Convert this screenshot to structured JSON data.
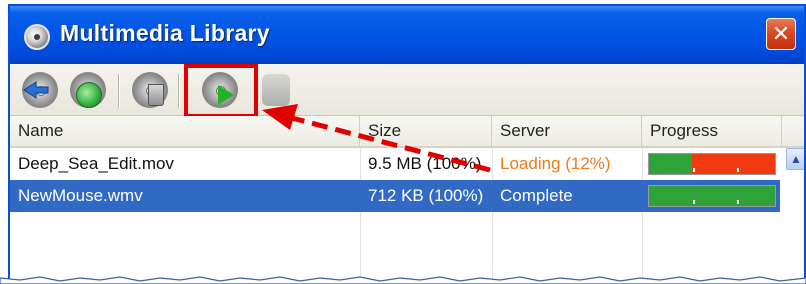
{
  "window": {
    "title": "Multimedia Library",
    "close_label": "✕"
  },
  "toolbar": {
    "buttons": [
      {
        "icon": "sync-arrows-icon",
        "state": "enabled"
      },
      {
        "icon": "globe-refresh-icon",
        "state": "enabled"
      },
      {
        "icon": "delete-disc-icon",
        "state": "enabled"
      },
      {
        "icon": "play-disc-icon",
        "state": "enabled",
        "highlighted": true
      },
      {
        "icon": "disabled-stop-icon",
        "state": "disabled"
      }
    ]
  },
  "list": {
    "columns": [
      "Name",
      "Size",
      "Server",
      "Progress"
    ],
    "rows": [
      {
        "name": "Deep_Sea_Edit.mov",
        "size": "9.5 MB (100%)",
        "server": "Loading (12%)",
        "progress_green": 0.34,
        "progress_red": 0.66,
        "selected": false
      },
      {
        "name": "NewMouse.wmv",
        "size": "712 KB (100%)",
        "server": "Complete",
        "progress_green": 1.0,
        "progress_red": 0.0,
        "selected": true
      }
    ]
  },
  "colors": {
    "titlebar": "#0055e5",
    "selection": "#316ac5",
    "loading_text": "#ee7a1c",
    "progress_green": "#2fa33a",
    "progress_red": "#f23a12",
    "callout_red": "#e00000"
  }
}
